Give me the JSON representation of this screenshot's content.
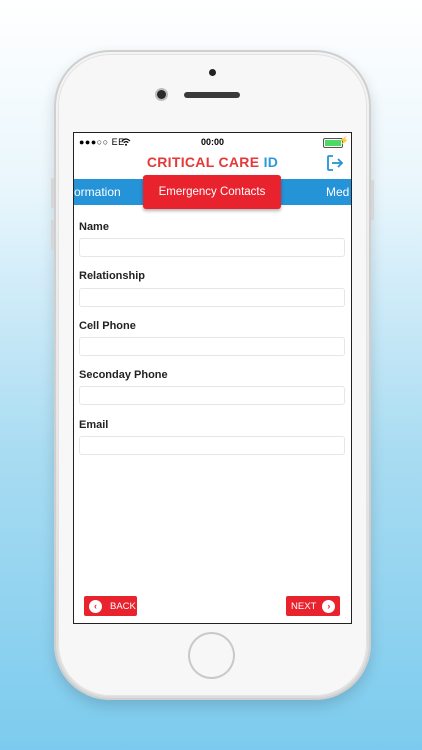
{
  "status_bar": {
    "carrier": "●●●○○ EE",
    "time": "00:00"
  },
  "header": {
    "brand_part1": "CRITICAL CARE",
    "brand_part2": "ID",
    "logout_icon": "logout-arrow-icon"
  },
  "tabs": {
    "left": "ormation",
    "active": "Emergency Contacts",
    "right": "Med"
  },
  "form": {
    "fields": [
      {
        "label": "Name",
        "value": ""
      },
      {
        "label": "Relationship",
        "value": ""
      },
      {
        "label": "Cell Phone",
        "value": ""
      },
      {
        "label": "Seconday Phone",
        "value": ""
      },
      {
        "label": "Email",
        "value": ""
      }
    ]
  },
  "footer": {
    "back_label": "BACK",
    "next_label": "NEXT"
  },
  "colors": {
    "brand_red": "#e8232e",
    "brand_blue": "#2493d8",
    "background_blue": "#7ccbee"
  }
}
